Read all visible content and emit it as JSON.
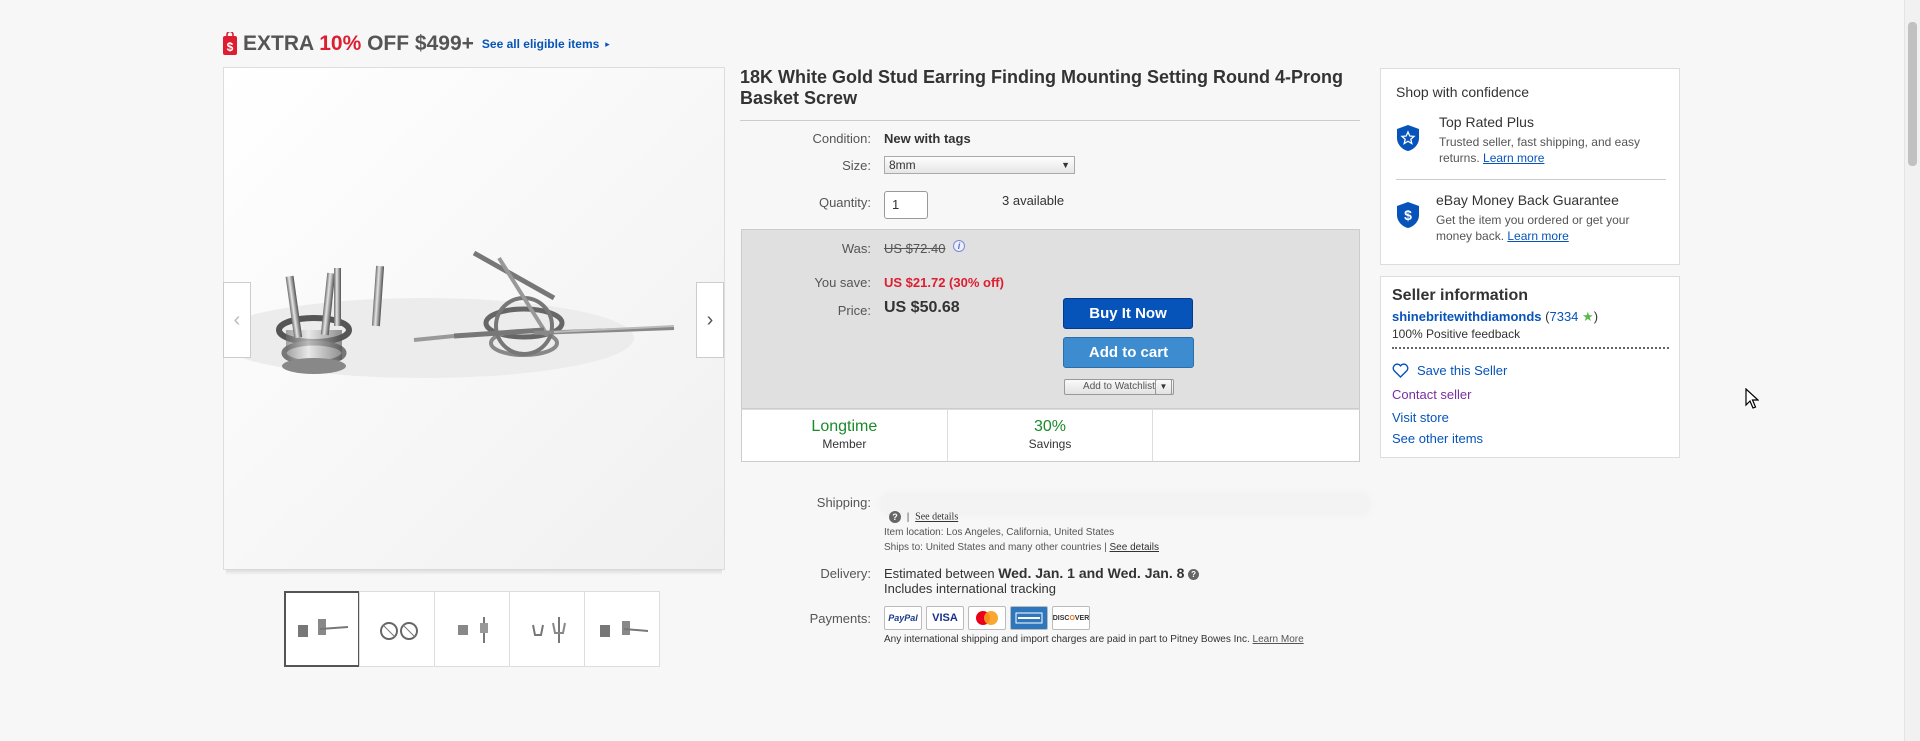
{
  "promo": {
    "prefix": "EXTRA ",
    "percent": "10%",
    "suffix": " OFF $499+",
    "link": "See all eligible items",
    "arrow": "▸"
  },
  "gallery": {
    "prev_arrow": "‹",
    "next_arrow": "›",
    "thumbnail_count": 5,
    "selected_thumbnail": 1
  },
  "item": {
    "title": "18K White Gold Stud Earring Finding Mounting Setting Round 4-Prong Basket Screw",
    "condition_label": "Condition:",
    "condition": "New with tags",
    "size_label": "Size:",
    "size_value": "8mm",
    "quantity_label": "Quantity:",
    "quantity": "1",
    "available": "3 available"
  },
  "pricing": {
    "was_label": "Was:",
    "was": "US $72.40",
    "save_label": "You save:",
    "save": "US $21.72 (30% off)",
    "price_label": "Price:",
    "price": "US $50.68",
    "buy_now": "Buy It Now",
    "add_to_cart": "Add to cart",
    "add_to_watchlist": "Add to Watchlist",
    "stats": [
      {
        "big": "Longtime",
        "small": "Member"
      },
      {
        "big": "30%",
        "small": "Savings"
      }
    ]
  },
  "shipping": {
    "label": "Shipping:",
    "see_details": "See details",
    "item_location": "Item location:  Los Angeles, California, United States",
    "ships_to": "Ships to:  United States and many other countries | ",
    "ships_to_link": "See details",
    "delivery_label": "Delivery:",
    "delivery_prefix": "Estimated between ",
    "delivery_dates": "Wed. Jan. 1 and Wed. Jan. 8",
    "delivery_tracking": "Includes international tracking",
    "payments_label": "Payments:",
    "payment_methods": [
      "PayPal",
      "VISA",
      "MasterCard",
      "AMEX",
      "DISCOVER"
    ],
    "payments_note": "Any international shipping and import charges are paid in part to Pitney Bowes Inc. ",
    "payments_note_link": "Learn More"
  },
  "confidence": {
    "title": "Shop with confidence",
    "top_rated_title": "Top Rated Plus",
    "top_rated_text": "Trusted seller, fast shipping, and easy returns. ",
    "top_rated_link": "Learn more",
    "guarantee_title": "eBay Money Back Guarantee",
    "guarantee_text": "Get the item you ordered or get your money back. ",
    "guarantee_link": "Learn more"
  },
  "seller": {
    "heading": "Seller information",
    "name": "shinebritewithdiamonds",
    "feedback_score": "7334",
    "positive": "100% Positive feedback",
    "save_seller": "Save this Seller",
    "contact": "Contact seller",
    "visit_store": "Visit store",
    "other_items": "See other items"
  },
  "colors": {
    "link": "#0654ba",
    "sale_red": "#dd1e31",
    "buy_blue": "#0654ba",
    "cart_blue": "#3d8ccf",
    "stat_green": "#1a8a2a"
  }
}
